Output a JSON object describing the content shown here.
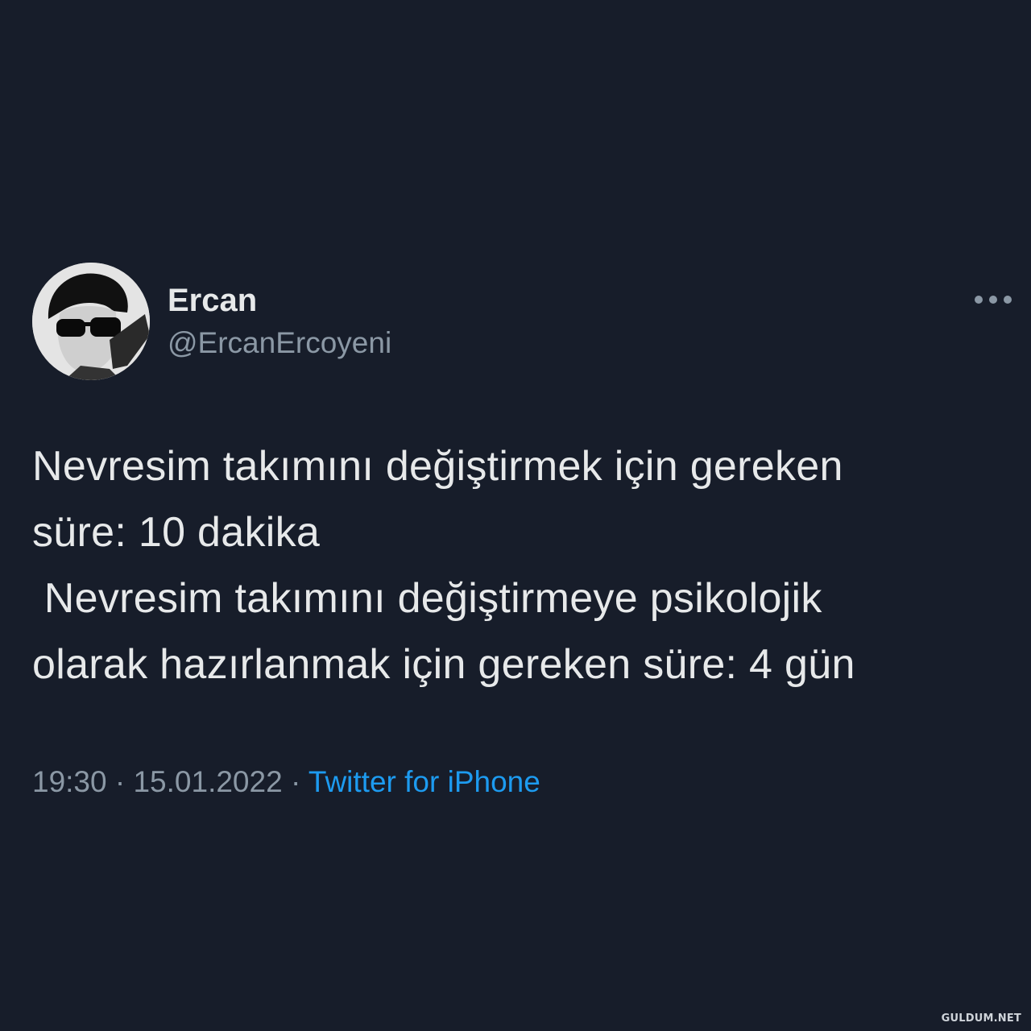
{
  "tweet": {
    "display_name": "Ercan",
    "handle": "@ErcanErcoyeni",
    "text": "Nevresim takımını değiştirmek için gereken\nsüre: 10 dakika\n Nevresim takımını değiştirmeye psikolojik\nolarak hazırlanmak için gereken süre: 4 gün",
    "time": "19:30",
    "separator": "·",
    "date": "15.01.2022",
    "source": "Twitter for iPhone",
    "more_icon": "more-horizontal-icon"
  },
  "watermark": "GULDUM.NET",
  "colors": {
    "background": "#171d2a",
    "primary_text": "#e7e9ea",
    "secondary_text": "#8b98a5",
    "link": "#1d9bf0"
  }
}
